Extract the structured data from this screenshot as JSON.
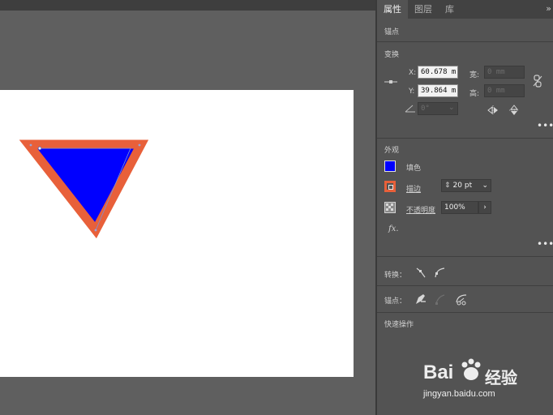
{
  "panel": {
    "tabs": [
      {
        "label": "属性",
        "active": true
      },
      {
        "label": "图层",
        "active": false
      },
      {
        "label": "库",
        "active": false
      }
    ],
    "collapse_glyph": "»",
    "selection_type": "锚点",
    "transform": {
      "title": "变换",
      "x_label": "X:",
      "x_value": "60.678 m",
      "y_label": "Y:",
      "y_value": "39.864 m",
      "w_label": "宽:",
      "w_value": "0 mm",
      "h_label": "高:",
      "h_value": "0 mm",
      "angle_value": "0°"
    },
    "appearance": {
      "title": "外观",
      "fill_label": "填色",
      "fill_color": "#0000ff",
      "stroke_label": "描边",
      "stroke_color": "#e8603a",
      "stroke_weight": "20 pt",
      "opacity_label": "不透明度",
      "opacity_value": "100%",
      "fx_label": "fx."
    },
    "convert": {
      "label": "转换："
    },
    "anchor": {
      "label": "锚点："
    },
    "quick_actions": {
      "title": "快速操作"
    }
  },
  "colors": {
    "triangle_fill": "#0000ff",
    "triangle_stroke": "#e8603a",
    "artboard": "#ffffff"
  },
  "watermark": {
    "brand": "Bai",
    "brand_cn": "经验",
    "url": "jingyan.baidu.com"
  }
}
